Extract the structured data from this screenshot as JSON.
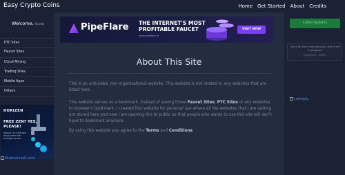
{
  "header": {
    "brand": "Easy Crypto Coins",
    "nav": [
      "Home",
      "Get Started",
      "About",
      "Credits"
    ]
  },
  "sidebar": {
    "welcome": "Welcome,",
    "guest": "Guest",
    "items": [
      "PTC Sites",
      "Faucet Sites",
      "Cloud Mining",
      "Trading Sites",
      "Mobile Apps",
      "Others"
    ],
    "ad": {
      "logo": "HORIZEN",
      "headline": "FREE ZEN? YES, PLEASE!",
      "sub": "WIN UP TO 2 ZEN PER HOUR WITH THE HORIZEN FAUCET",
      "image_alt": "Multicoinads.com"
    }
  },
  "main": {
    "banner": {
      "brand": "PipeFlare",
      "headline_line1": "THE INTERNET'S MOST",
      "headline_line2": "PROFITABLE FAUCET",
      "url": "www.pipeflare.io",
      "button": "VISIT NOW"
    },
    "title": "About This Site",
    "para1": "This is an unfunded, non-organisational website. This website is not related to any websites that are listed here.",
    "para2_a": "This website serves as a bookmark. Instead of saving those ",
    "para2_b1": "Faucet Sites",
    "para2_c": ", ",
    "para2_b2": "PTC Sites",
    "para2_d": " or any websites to browser's bookmark, I created this website for personal use where all the websites that I am visiting are stored here and now I am opening this to public so that people who wants to use this site will don't have to bookmark anymore.",
    "para3_a": "By using this website you agree to the ",
    "para3_b1": "Terms",
    "para3_c": " and ",
    "para3_b2": "Conditions",
    "para3_d": "."
  },
  "right": {
    "updates_button": "Latest Updates",
    "notice": "Sorry for the inconvenience, site is still in progress.",
    "notice_date": "02/02/2023 · Admin",
    "image_alt": "cointiply"
  },
  "colors": {
    "background": "#1b2234",
    "panel": "#242c40",
    "accent_green": "#1b7a3c",
    "accent_purple": "#7b3ff2",
    "link": "#4d8ef0"
  }
}
